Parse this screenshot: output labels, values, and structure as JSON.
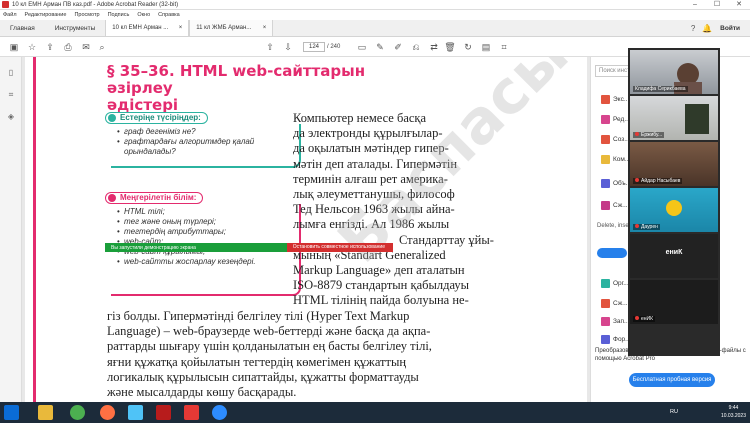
{
  "window": {
    "title": "10 кл ЕМН Арман ПВ каз.pdf - Adobe Acrobat Reader (32-bit)"
  },
  "menu": [
    "Файл",
    "Редактирование",
    "Просмотр",
    "Подпись",
    "Окно",
    "Справка"
  ],
  "tabs": {
    "home": "Главная",
    "tools": "Инструменты",
    "doc1": "10 кл ЕМН Арман ...",
    "doc2": "11 кл ЖМБ Арман...",
    "close": "×",
    "login": "Войти"
  },
  "toolbar": {
    "page_current": "124",
    "page_total": "/ 240"
  },
  "document": {
    "section_title_line1": "§ 35–36. HTML web-сайттарын әзірлеу",
    "section_title_line2": "әдістері",
    "recall_label": "Естеріңе түсіріңдер:",
    "recall_items": [
      "граф дегеніміз не?",
      "графтардағы алгоритмдер қалай орындалады?"
    ],
    "learn_label": "Меңгерілетін білім:",
    "learn_items": [
      "HTML тілі;",
      "тег және оның түрлері;",
      "тегтердің атрибуттары;",
      "web-сайт;",
      "web-сайт құрылымы;",
      "web-сайтты жоспарлау кезеңдері."
    ],
    "paragraph_lines_right": [
      "Компьютер немесе басқа",
      "да электронды құрылғылар-",
      "да оқылатын мәтіндер гипер-",
      "мәтін деп аталады. Гипермәтін",
      "терминін алғаш рет америка-",
      "лық әлеуметтанушы, философ",
      "Тед Нельсон 1963 жылы айна-",
      "лымға енгізді. Ал 1986 жылы",
      "Стандарттау ұйы-",
      "мының «Standart Generalized",
      "Markup Language» деп аталатын",
      "ISO-8879 стандартын қабылдауы",
      "HTML тілінің пайда болуына не-"
    ],
    "paragraph_lines_full": [
      "гіз болды. Гипермәтінді белгілеу тілі (Hyper Text Markup",
      "Language) – web-браузерде web-беттерді және басқа да ақпа-",
      "раттарды шығару үшін қолданылатын ең басты белгілеу тілі,",
      "яғни құжатқа қойылатын тегтердің көмегімен құжаттың",
      "логикалық құрылысын сипаттайды, құжатты форматтауды",
      "және мысалдарды көшу басқарады."
    ],
    "watermark": "Баспасы"
  },
  "share_bar": {
    "status": "Вы запустили демонстрацию экрана",
    "stop": "Остановить совместное использование"
  },
  "right_panel": {
    "search_placeholder": "Поиск инст...",
    "items": [
      "Экс...",
      "Ред...",
      "Соз...",
      "Ком...",
      "Объ...",
      "Сж...",
      "Орг...",
      "Сж...",
      "Зап...",
      "Фор..."
    ],
    "delete": "Delete, inse...",
    "promo": "Преобразовывайте и изменяйте файлы PDF-файлы с помощью Acrobat Pro",
    "trial_button": "Бесплатная пробная версия"
  },
  "video": {
    "participants": [
      {
        "name": "Кладифа Серикбаева"
      },
      {
        "name": "Ержибу..."
      },
      {
        "name": "Айдар Насыбаев"
      },
      {
        "name": "Даурен"
      },
      {
        "name": "",
        "label": "ениК"
      },
      {
        "name": "енИК"
      }
    ]
  },
  "taskbar": {
    "lang": "RU",
    "time": "9:44",
    "date": "10.03.2023"
  },
  "colors": {
    "accent_pink": "#e32b6e",
    "accent_teal": "#2bb3a0",
    "share_green": "#1a9e3a",
    "stop_red": "#d32f2f",
    "acrobat_blue": "#2680eb"
  }
}
